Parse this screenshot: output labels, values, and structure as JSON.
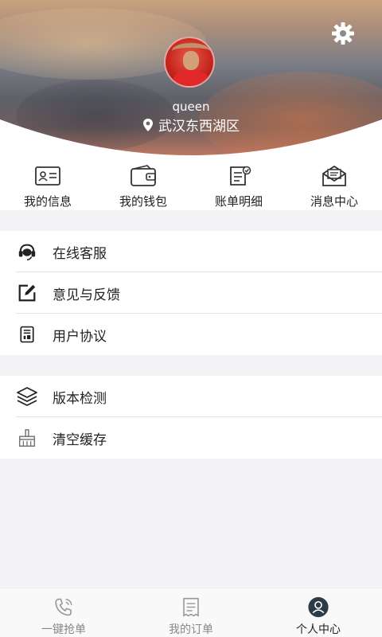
{
  "profile": {
    "username": "queen",
    "location": "武汉东西湖区"
  },
  "quick_actions": [
    {
      "label": "我的信息",
      "icon": "id-card-icon"
    },
    {
      "label": "我的钱包",
      "icon": "wallet-icon"
    },
    {
      "label": "账单明细",
      "icon": "bill-detail-icon"
    },
    {
      "label": "消息中心",
      "icon": "mail-icon"
    }
  ],
  "menu_group_1": [
    {
      "label": "在线客服",
      "icon": "headset-icon"
    },
    {
      "label": "意见与反馈",
      "icon": "edit-icon"
    },
    {
      "label": "用户协议",
      "icon": "document-icon"
    }
  ],
  "menu_group_2": [
    {
      "label": "版本检测",
      "icon": "layers-icon"
    },
    {
      "label": "清空缓存",
      "icon": "broom-icon"
    }
  ],
  "tabbar": [
    {
      "label": "一键抢单",
      "icon": "phone-call-icon",
      "active": false
    },
    {
      "label": "我的订单",
      "icon": "order-list-icon",
      "active": false
    },
    {
      "label": "个人中心",
      "icon": "user-icon",
      "active": true
    }
  ],
  "colors": {
    "text": "#222222",
    "muted": "#888888",
    "divider": "#e3e3e3",
    "background": "#f4f4f6",
    "active_tab_icon": "#2c3a4a"
  }
}
